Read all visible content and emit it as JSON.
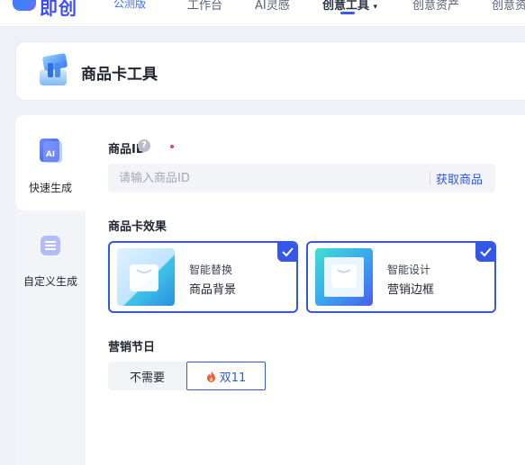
{
  "nav": {
    "logo_text": "即创",
    "beta_tag": "公测版",
    "items": [
      {
        "label": "工作台"
      },
      {
        "label": "AI灵感"
      },
      {
        "label": "创意工具"
      },
      {
        "label": "创意资产"
      },
      {
        "label": "创意资产"
      }
    ]
  },
  "header": {
    "title": "商品卡工具"
  },
  "sidebar": {
    "items": [
      {
        "label": "快速生成",
        "active": true
      },
      {
        "label": "自定义生成",
        "active": false
      }
    ]
  },
  "form": {
    "product_id": {
      "label": "商品ID",
      "placeholder": "请输入商品ID",
      "value": "",
      "action": "获取商品"
    },
    "effect": {
      "label": "商品卡效果",
      "options": [
        {
          "sub": "智能替换",
          "main": "商品背景",
          "checked": true
        },
        {
          "sub": "智能设计",
          "main": "营销边框",
          "checked": true
        }
      ]
    },
    "festival": {
      "label": "营销节日",
      "options": [
        {
          "label": "不需要",
          "selected": false
        },
        {
          "label": "双11",
          "selected": true
        }
      ]
    }
  },
  "colors": {
    "accent": "#3656e8",
    "link": "#2d58e6",
    "required": "#e5484d",
    "page_bg": "#eef1f7"
  }
}
